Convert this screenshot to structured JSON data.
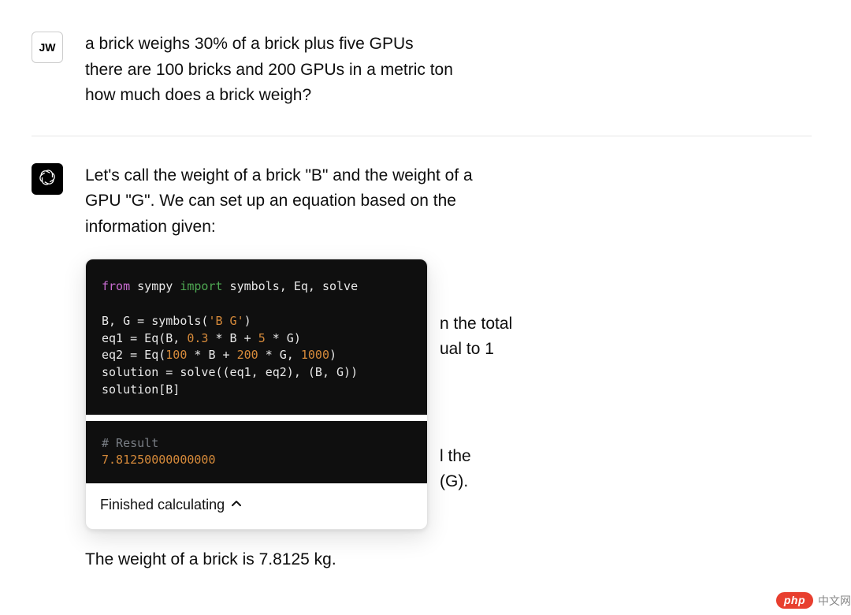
{
  "user": {
    "initials": "JW",
    "line1": "a brick weighs 30% of a brick plus five GPUs",
    "line2": "there are 100 bricks and 200 GPUs in a metric ton",
    "line3": "how much does a brick weigh?"
  },
  "assistant": {
    "intro": "Let's call the weight of a brick \"B\" and the weight of a GPU \"G\". We can set up an equation based on the information given:",
    "code": {
      "l1_from": "from",
      "l1_mod": " sympy ",
      "l1_import": "import",
      "l1_rest": " symbols, Eq, solve",
      "l2a": "B, G = symbols(",
      "l2_str": "'B G'",
      "l2b": ")",
      "l3a": "eq1 = Eq(B, ",
      "l3_n1": "0.3",
      "l3b": " * B + ",
      "l3_n2": "5",
      "l3c": " * G)",
      "l4a": "eq2 = Eq(",
      "l4_n1": "100",
      "l4b": " * B + ",
      "l4_n2": "200",
      "l4c": " * G, ",
      "l4_n3": "1000",
      "l4d": ")",
      "l5": "solution = solve((eq1, eq2), (B, G))",
      "l6": "solution[B]"
    },
    "result": {
      "comment": "# Result",
      "value": "7.81250000000000"
    },
    "footer": "Finished calculating",
    "behind1": "n the total",
    "behind2": "ual to 1",
    "behind3": "l the",
    "behind4": " (G).",
    "final": "The weight of a brick is 7.8125 kg."
  },
  "watermark": {
    "pill": "php",
    "text": "中文网"
  }
}
